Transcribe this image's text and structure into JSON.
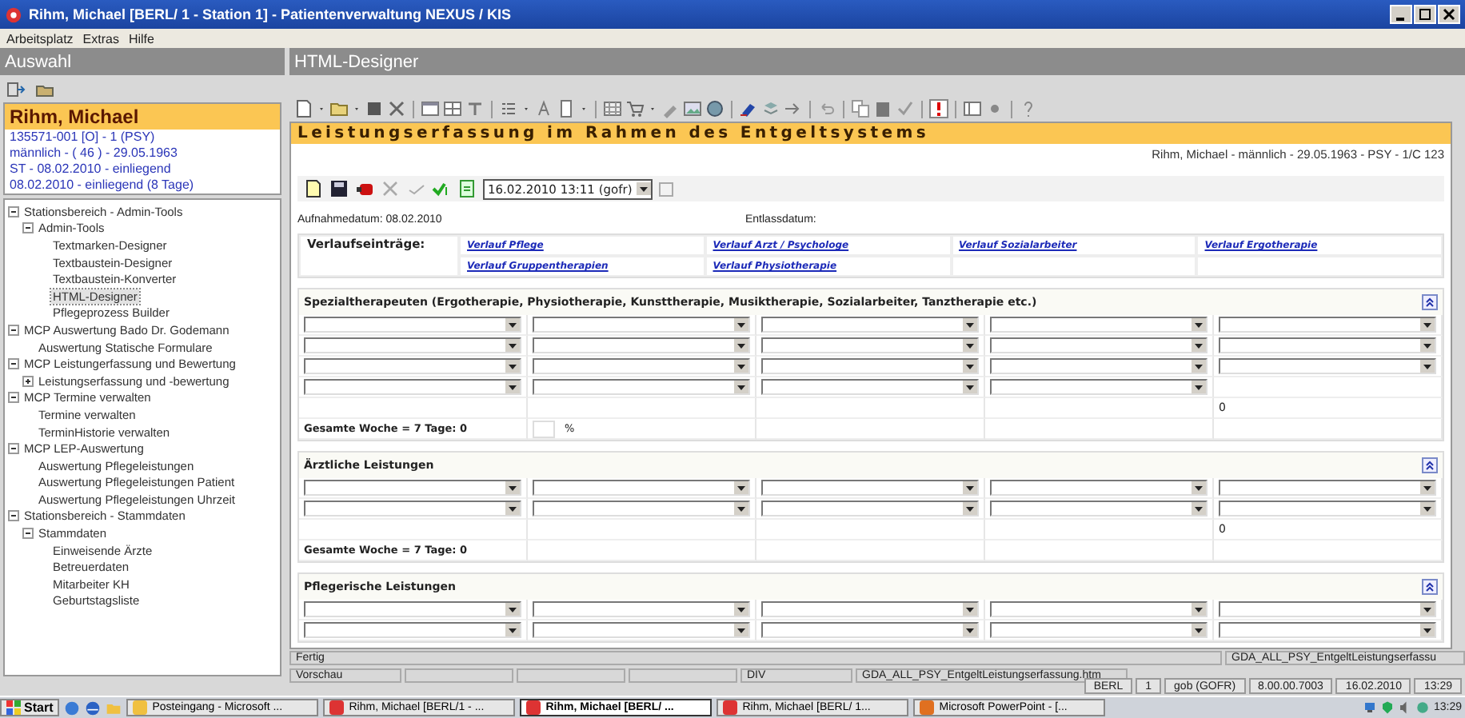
{
  "window": {
    "title": "Rihm, Michael [BERL/ 1 - Station 1] - Patientenverwaltung NEXUS / KIS"
  },
  "menu": [
    "Arbeitsplatz",
    "Extras",
    "Hilfe"
  ],
  "left_pane": {
    "title": "Auswahl",
    "patient": {
      "name": "Rihm, Michael",
      "lines": [
        "135571-001 [O] - 1 (PSY)",
        "männlich - ( 46 ) - 29.05.1963",
        "ST - 08.02.2010 - einliegend",
        "08.02.2010 - einliegend (8 Tage)"
      ]
    },
    "tree": [
      {
        "label": "Stationsbereich - Admin-Tools",
        "expanded": true,
        "selected": false,
        "children": [
          {
            "label": "Admin-Tools",
            "expanded": true,
            "selected": false,
            "children": [
              {
                "label": "Textmarken-Designer",
                "selected": false
              },
              {
                "label": "Textbaustein-Designer",
                "selected": false
              },
              {
                "label": "Textbaustein-Konverter",
                "selected": false
              },
              {
                "label": "HTML-Designer",
                "selected": true
              },
              {
                "label": "Pflegeprozess Builder",
                "selected": false
              }
            ]
          }
        ]
      },
      {
        "label": "MCP Auswertung Bado Dr. Godemann",
        "expanded": true,
        "selected": false,
        "children": [
          {
            "label": "Auswertung Statische Formulare",
            "selected": false
          }
        ]
      },
      {
        "label": "MCP Leistungerfassung und Bewertung",
        "expanded": true,
        "selected": false,
        "children": [
          {
            "label": "Leistungserfassung und -bewertung",
            "expanded": false,
            "selected": false
          }
        ]
      },
      {
        "label": "MCP Termine verwalten",
        "expanded": true,
        "selected": false,
        "children": [
          {
            "label": "Termine verwalten",
            "selected": false
          },
          {
            "label": "TerminHistorie verwalten",
            "selected": false
          }
        ]
      },
      {
        "label": "MCP LEP-Auswertung",
        "expanded": true,
        "selected": false,
        "children": [
          {
            "label": "Auswertung Pflegeleistungen",
            "selected": false
          },
          {
            "label": "Auswertung Pflegeleistungen Patient",
            "selected": false
          },
          {
            "label": "Auswertung Pflegeleistungen Uhrzeit",
            "selected": false
          }
        ]
      },
      {
        "label": "Stationsbereich - Stammdaten",
        "expanded": true,
        "selected": false,
        "children": [
          {
            "label": "Stammdaten",
            "expanded": true,
            "selected": false,
            "children": [
              {
                "label": "Einweisende Ärzte",
                "selected": false
              },
              {
                "label": "Betreuerdaten",
                "selected": false
              },
              {
                "label": "Mitarbeiter KH",
                "selected": false
              },
              {
                "label": "Geburtstagsliste",
                "selected": false
              }
            ]
          }
        ]
      }
    ]
  },
  "right_pane": {
    "title": "HTML-Designer",
    "document": {
      "title": "Leistungserfassung im Rahmen des Entgeltsystems",
      "patient_line": "Rihm, Michael - männlich - 29.05.1963 - PSY - 1/C 123",
      "date_select": {
        "value": "16.02.2010 13:11 (gofr)"
      },
      "option_checkbox": {
        "checked": false
      },
      "admission": "Aufnahmedatum: 08.02.2010",
      "discharge": "Entlassdatum:",
      "history": {
        "label": "Verlaufseinträge:",
        "links": [
          "Verlauf Pflege",
          "Verlauf Arzt / Psychologe",
          "Verlauf Sozialarbeiter",
          "Verlauf Ergotherapie",
          "Verlauf Gruppentherapien",
          "Verlauf Physiotherapie"
        ]
      },
      "sections": [
        {
          "title": "Spezialtherapeuten (Ergotherapie, Physiotherapie, Kunsttherapie, Musiktherapie, Sozialarbeiter, Tanztherapie etc.)",
          "rows": [
            [
              {
                "kind": "dropdown"
              },
              {
                "kind": "dropdown"
              },
              {
                "kind": "dropdown"
              },
              {
                "kind": "dropdown"
              },
              {
                "kind": "dropdown"
              }
            ],
            [
              {
                "kind": "dropdown"
              },
              {
                "kind": "dropdown"
              },
              {
                "kind": "dropdown"
              },
              {
                "kind": "dropdown"
              },
              {
                "kind": "dropdown"
              }
            ],
            [
              {
                "kind": "dropdown"
              },
              {
                "kind": "dropdown"
              },
              {
                "kind": "dropdown"
              },
              {
                "kind": "dropdown"
              },
              {
                "kind": "dropdown"
              }
            ],
            [
              {
                "kind": "dropdown"
              },
              {
                "kind": "dropdown"
              },
              {
                "kind": "dropdown"
              },
              {
                "kind": "dropdown"
              },
              {
                "kind": "empty"
              }
            ],
            [
              {
                "kind": "empty"
              },
              {
                "kind": "empty"
              },
              {
                "kind": "empty"
              },
              {
                "kind": "empty"
              },
              {
                "kind": "text",
                "text": "0"
              }
            ],
            [
              {
                "kind": "total",
                "text": "Gesamte Woche = 7 Tage: 0"
              },
              {
                "kind": "percent",
                "unit": "%"
              },
              {
                "kind": "empty"
              },
              {
                "kind": "empty"
              },
              {
                "kind": "empty"
              }
            ]
          ]
        },
        {
          "title": "Ärztliche Leistungen",
          "rows": [
            [
              {
                "kind": "dropdown"
              },
              {
                "kind": "dropdown"
              },
              {
                "kind": "dropdown"
              },
              {
                "kind": "dropdown"
              },
              {
                "kind": "dropdown"
              }
            ],
            [
              {
                "kind": "dropdown"
              },
              {
                "kind": "dropdown"
              },
              {
                "kind": "dropdown"
              },
              {
                "kind": "dropdown"
              },
              {
                "kind": "dropdown"
              }
            ],
            [
              {
                "kind": "empty"
              },
              {
                "kind": "empty"
              },
              {
                "kind": "empty"
              },
              {
                "kind": "empty"
              },
              {
                "kind": "text",
                "text": "0"
              }
            ],
            [
              {
                "kind": "total",
                "text": "Gesamte Woche = 7 Tage: 0"
              },
              {
                "kind": "empty"
              },
              {
                "kind": "empty"
              },
              {
                "kind": "empty"
              },
              {
                "kind": "empty"
              }
            ]
          ]
        },
        {
          "title": "Pflegerische Leistungen",
          "rows": [
            [
              {
                "kind": "dropdown"
              },
              {
                "kind": "dropdown"
              },
              {
                "kind": "dropdown"
              },
              {
                "kind": "dropdown"
              },
              {
                "kind": "dropdown"
              }
            ],
            [
              {
                "kind": "dropdown"
              },
              {
                "kind": "dropdown"
              },
              {
                "kind": "dropdown"
              },
              {
                "kind": "dropdown"
              },
              {
                "kind": "dropdown"
              }
            ]
          ]
        }
      ]
    },
    "status": {
      "message": "Fertig",
      "file": "GDA_ALL_PSY_EntgeltLeistungserfassu"
    },
    "preview_bar": {
      "label": "Vorschau",
      "element": "DIV",
      "file": "GDA_ALL_PSY_EntgeltLeistungserfassung.htm"
    }
  },
  "status_bar": [
    "BERL",
    "1",
    "gob (GOFR)",
    "8.00.00.7003",
    "16.02.2010",
    "13:29"
  ],
  "taskbar": {
    "start": "Start",
    "tasks": [
      {
        "label": "Posteingang - Microsoft ...",
        "selected": false
      },
      {
        "label": "Rihm, Michael [BERL/1 - ...",
        "selected": false
      },
      {
        "label": "Rihm, Michael [BERL/ ...",
        "selected": true
      },
      {
        "label": "Rihm, Michael [BERL/ 1...",
        "selected": false
      },
      {
        "label": "Microsoft PowerPoint - [...",
        "selected": false
      }
    ],
    "clock": "13:29"
  }
}
